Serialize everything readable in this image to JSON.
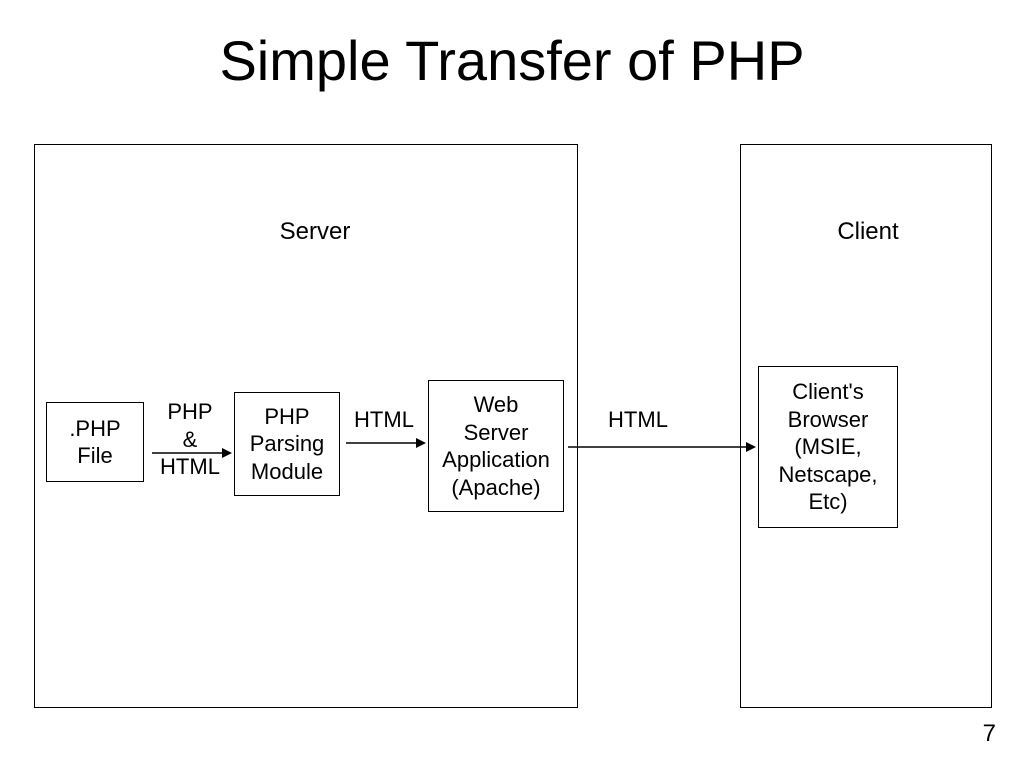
{
  "title": "Simple Transfer of PHP",
  "page_number": "7",
  "containers": {
    "server": {
      "label": "Server"
    },
    "client": {
      "label": "Client"
    }
  },
  "nodes": {
    "php_file": ".PHP\nFile",
    "php_parser": "PHP\nParsing\nModule",
    "web_server": "Web\nServer\nApplication\n(Apache)",
    "browser": "Client's\nBrowser\n(MSIE,\nNetscape,\nEtc)"
  },
  "edges": {
    "file_to_parser": "PHP\n&\nHTML",
    "parser_to_webserver": "HTML",
    "webserver_to_browser": "HTML"
  }
}
